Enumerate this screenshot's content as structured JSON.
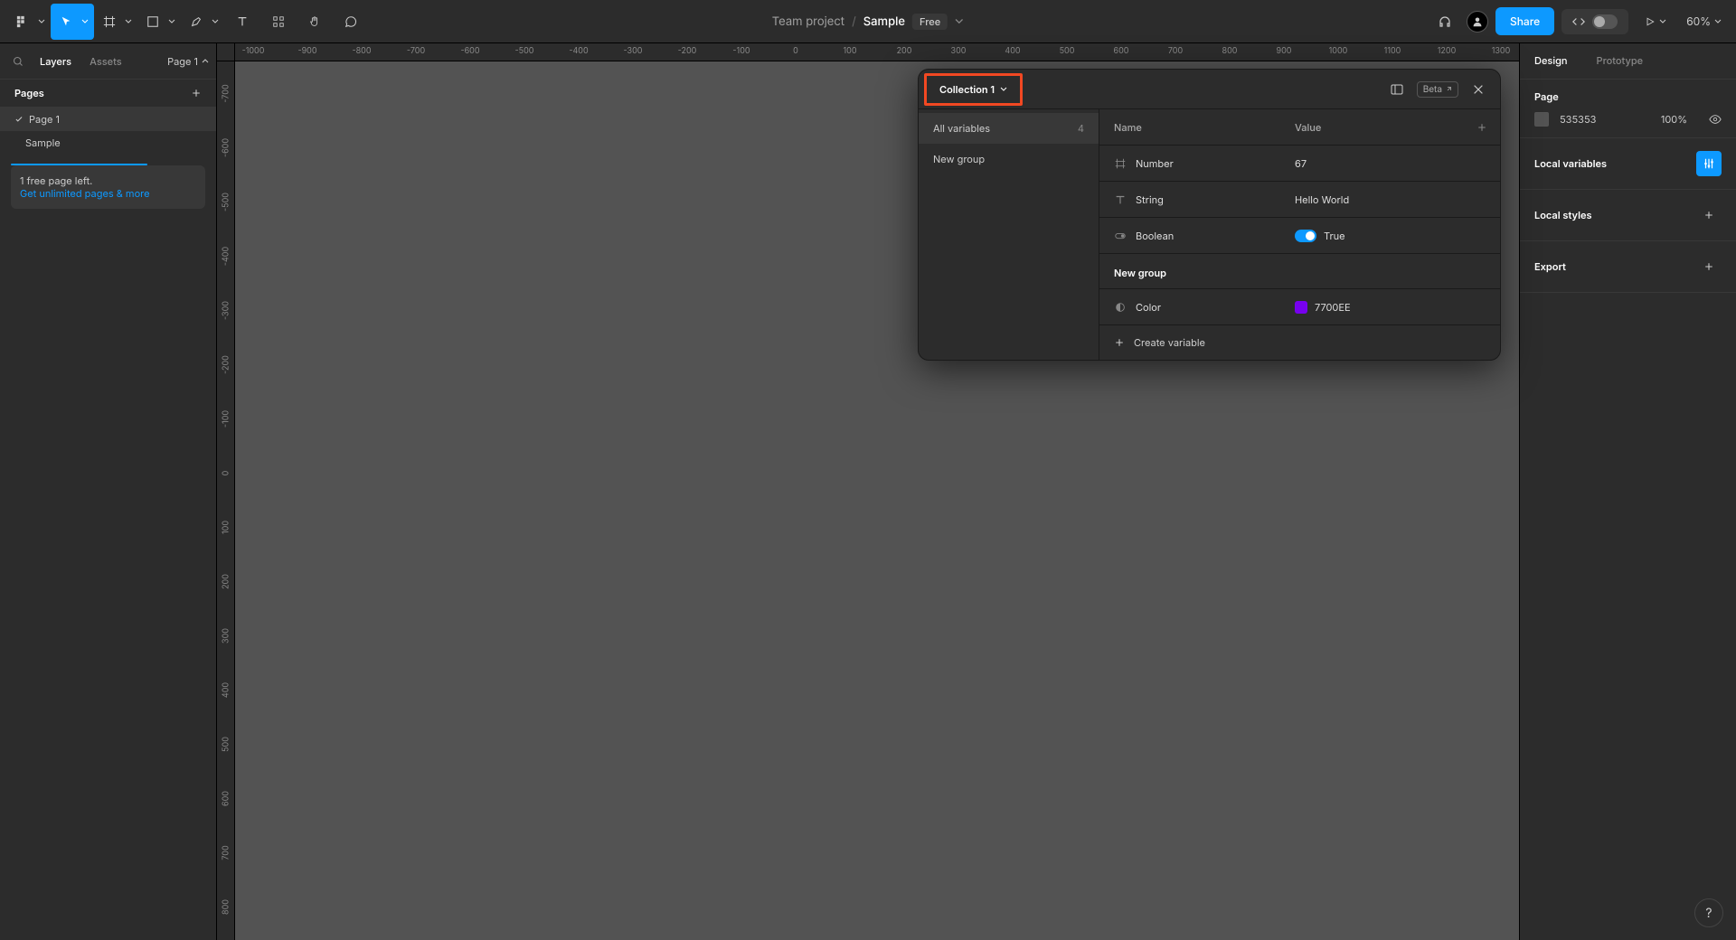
{
  "toolbar": {
    "project": "Team project",
    "file": "Sample",
    "plan_badge": "Free",
    "share_label": "Share",
    "zoom": "60%"
  },
  "left_panel": {
    "tabs": {
      "layers": "Layers",
      "assets": "Assets"
    },
    "page_selector": "Page 1",
    "pages_header": "Pages",
    "pages": [
      {
        "name": "Page 1",
        "selected": true
      },
      {
        "name": "Sample",
        "selected": false
      }
    ],
    "promo_line1": "1 free page left.",
    "promo_line2": "Get unlimited pages & more"
  },
  "ruler": {
    "h": [
      "-1000",
      "-900",
      "-800",
      "-700",
      "-600",
      "-500",
      "-400",
      "-300",
      "-200",
      "-100",
      "0",
      "100",
      "200",
      "300",
      "400",
      "500",
      "600",
      "700",
      "800",
      "900",
      "1000",
      "1100",
      "1200",
      "1300"
    ],
    "v": [
      "-700",
      "-600",
      "-500",
      "-400",
      "-300",
      "-200",
      "-100",
      "0",
      "100",
      "200",
      "300",
      "400",
      "500",
      "600",
      "700",
      "800"
    ]
  },
  "right_panel": {
    "tabs": {
      "design": "Design",
      "prototype": "Prototype"
    },
    "page_section_label": "Page",
    "bg_color": "535353",
    "bg_opacity": "100%",
    "local_variables_label": "Local variables",
    "local_styles_label": "Local styles",
    "export_label": "Export"
  },
  "variables_modal": {
    "collection_name": "Collection 1",
    "beta_label": "Beta",
    "sidebar": {
      "all_variables_label": "All variables",
      "all_variables_count": "4",
      "groups": [
        "New group"
      ]
    },
    "columns": {
      "name": "Name",
      "value": "Value"
    },
    "rows": [
      {
        "type": "number",
        "name": "Number",
        "value": "67"
      },
      {
        "type": "string",
        "name": "String",
        "value": "Hello World"
      },
      {
        "type": "boolean",
        "name": "Boolean",
        "value": "True"
      }
    ],
    "group_header": "New group",
    "group_rows": [
      {
        "type": "color",
        "name": "Color",
        "value": "7700EE",
        "swatch": "#7700EE"
      }
    ],
    "create_label": "Create variable"
  },
  "help": "?"
}
